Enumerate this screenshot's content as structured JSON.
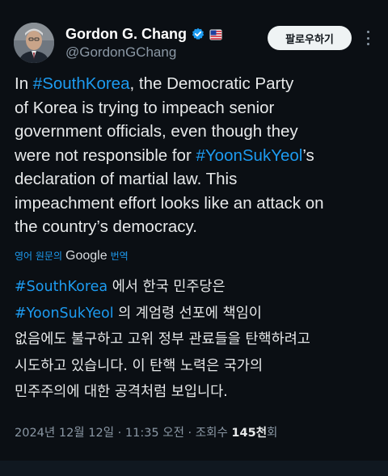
{
  "author": {
    "display_name": "Gordon G. Chang",
    "handle": "@GordonGChang",
    "verified_icon": "verified-badge-icon",
    "affiliation_icon": "flag-badge-icon"
  },
  "follow_button_label": "팔로우하기",
  "tweet_en": {
    "line1_pre": "In ",
    "line1_tag": "#SouthKorea",
    "line1_post": ", the Democratic Party",
    "line2": "of Korea is trying to impeach senior",
    "line3": "government officials, even though they",
    "line4_pre": "were not responsible for ",
    "line4_tag": "#YoonSukYeol",
    "line4_post": "’s",
    "line5": "declaration of martial law. This",
    "line6": "impeachment effort looks like an attack on",
    "line7": "the country’s democracy."
  },
  "translation": {
    "prefix": "영어 원문의",
    "provider": "Google",
    "suffix": "번역"
  },
  "tweet_ko": {
    "line1_tag": "#SouthKorea",
    "line1_post": " 에서 한국 민주당은",
    "line2_tag": "#YoonSukYeol",
    "line2_post": " 의 계엄령 선포에 책임이",
    "line3": "없음에도 불구하고 고위 정부 관료들을 탄핵하려고",
    "line4": "시도하고 있습니다. 이 탄핵 노력은 국가의",
    "line5": "민주주의에 대한 공격처럼 보입니다."
  },
  "meta": {
    "date": "2024년 12월 12일",
    "sep1": " · ",
    "time": "11:35 오전",
    "sep2": " · ",
    "views_label": "조회수 ",
    "views_count": "145천",
    "views_suffix": "회"
  },
  "colors": {
    "background": "#0b0f14",
    "text": "#e7e9ea",
    "secondary": "#8b98a5",
    "link": "#1d9bf0",
    "verified": "#1d9bf0"
  }
}
